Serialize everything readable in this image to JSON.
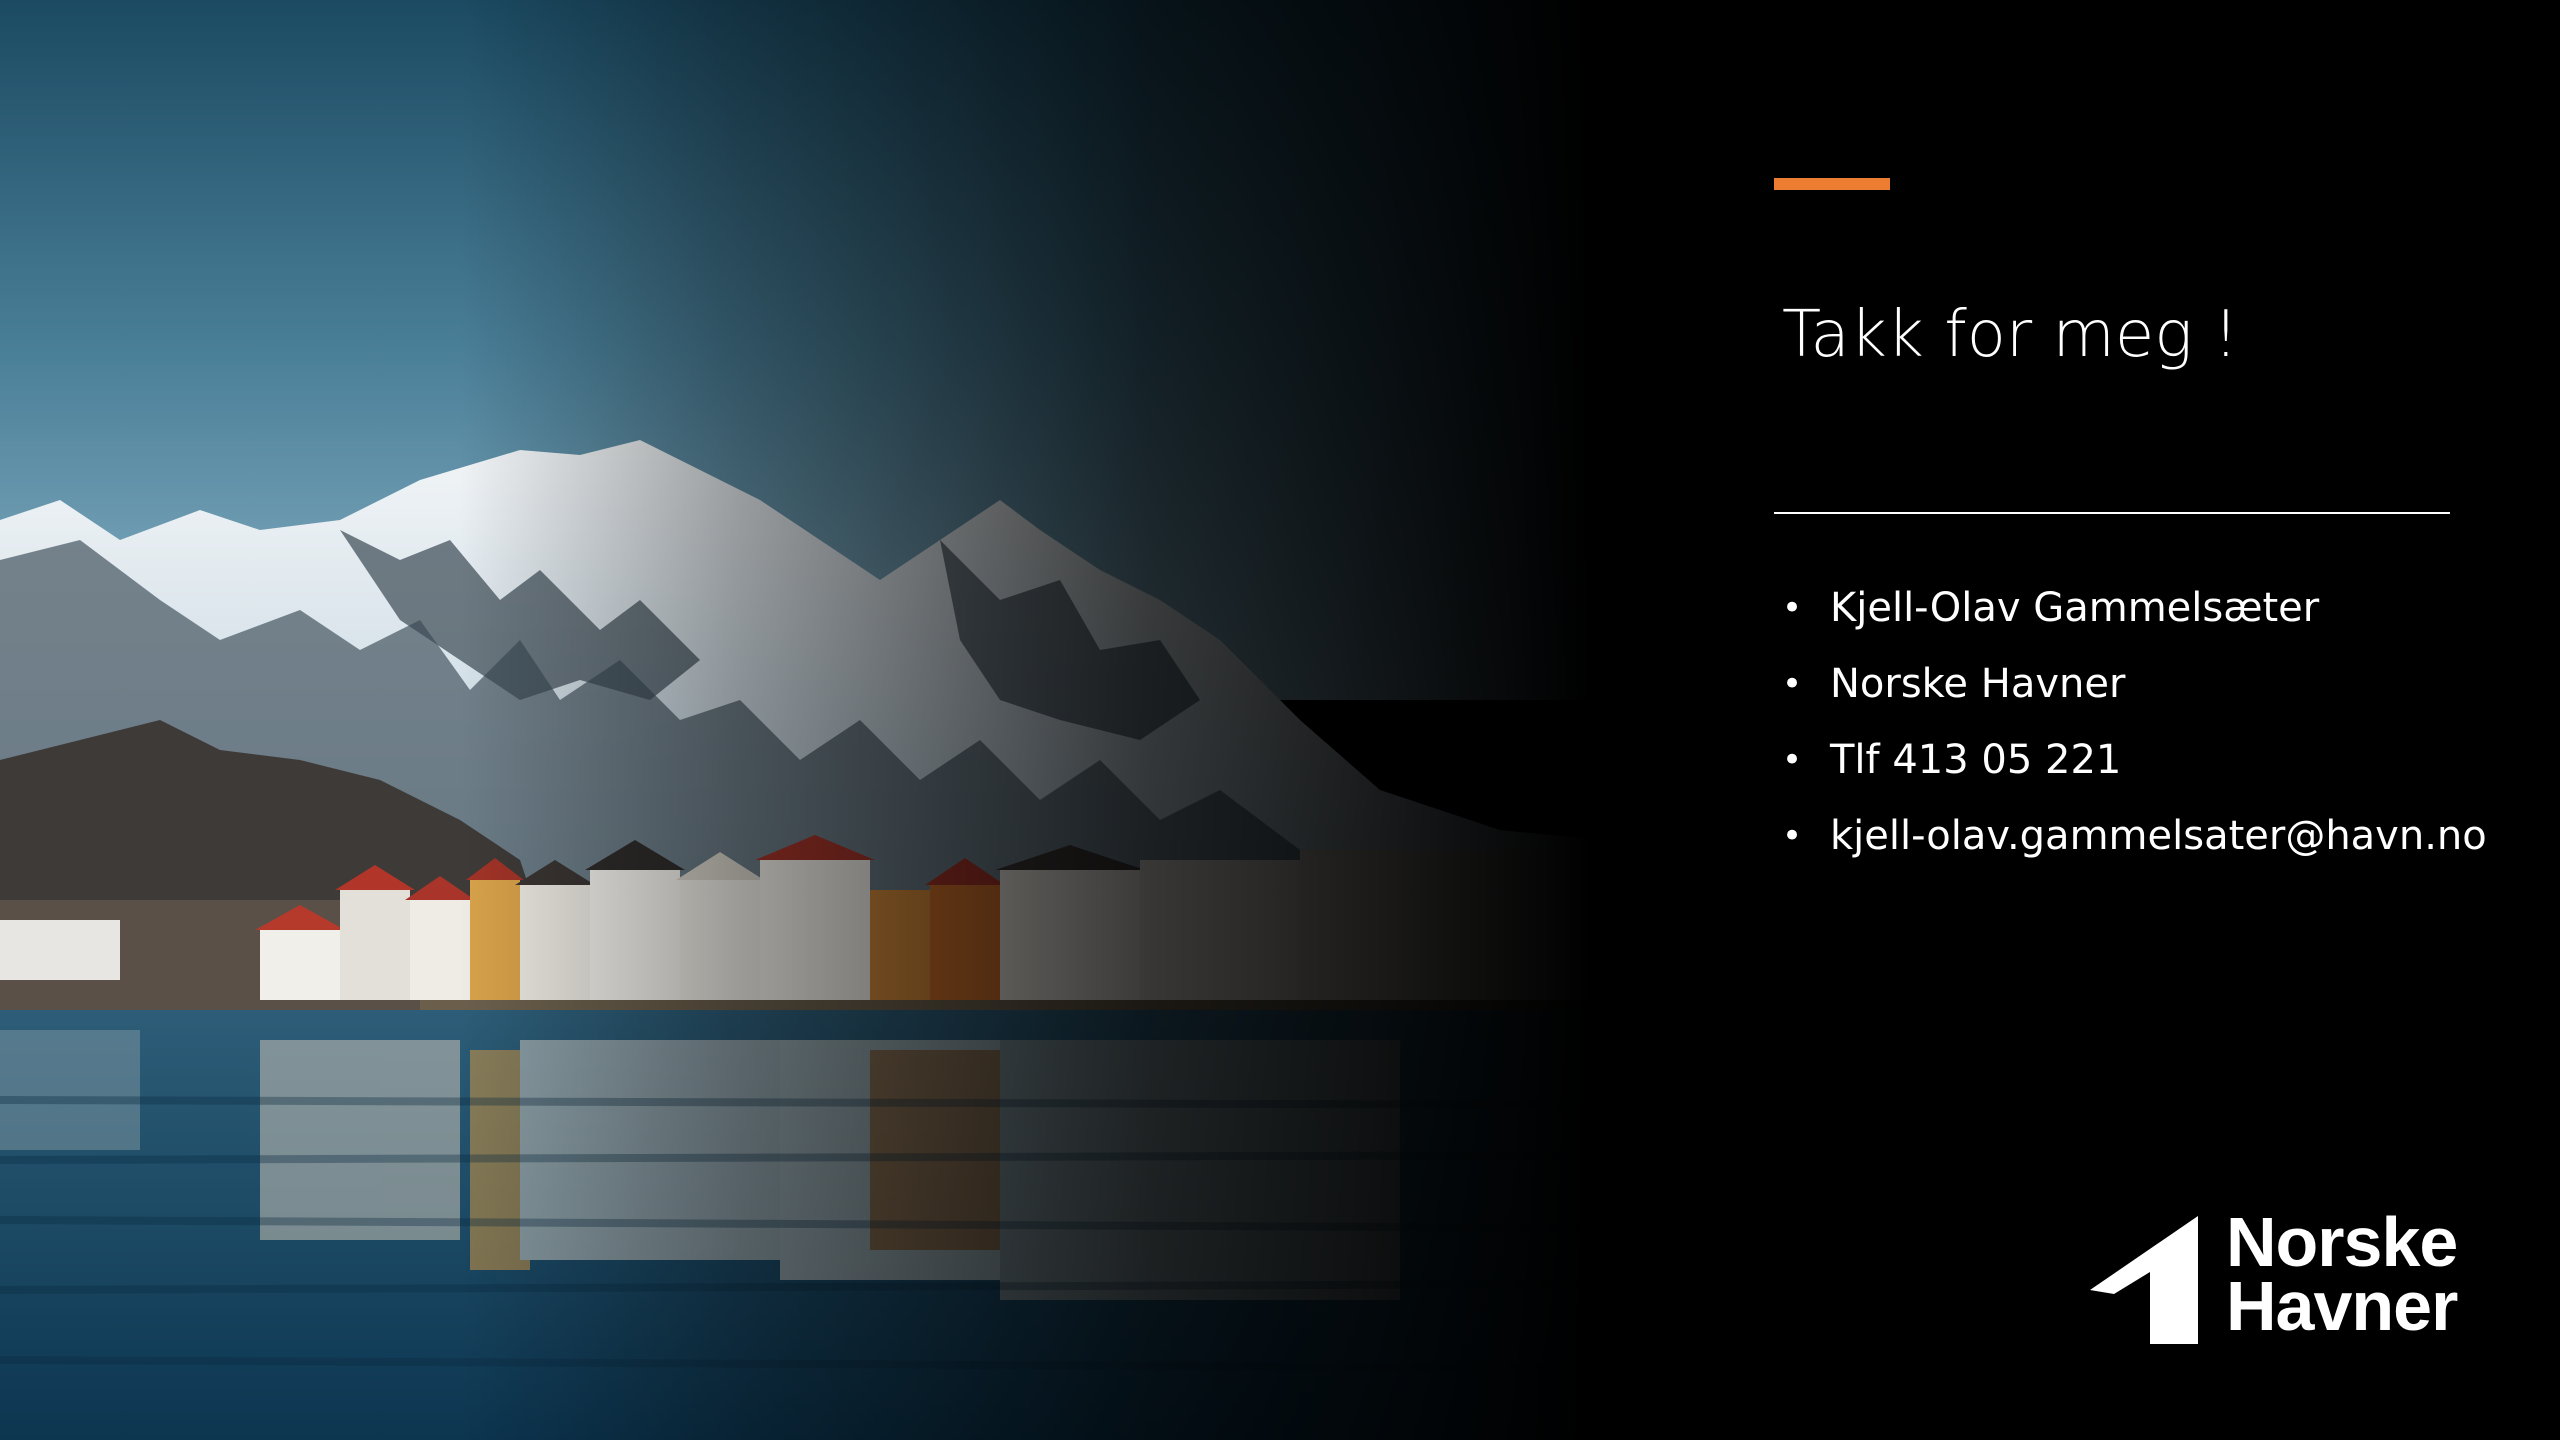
{
  "slide": {
    "title": "Takk for meg !",
    "contact_items": [
      "Kjell-Olav Gammelsæter",
      "Norske Havner",
      "Tlf 413 05 221",
      "kjell-olav.gammelsater@havn.no"
    ],
    "bullet_char": "•"
  },
  "logo": {
    "line1": "Norske",
    "line2": "Havner"
  },
  "colors": {
    "accent": "#ED7D31",
    "background": "#000000",
    "text": "#FFFFFF"
  },
  "image": {
    "description_icon": "harbor-photo"
  }
}
